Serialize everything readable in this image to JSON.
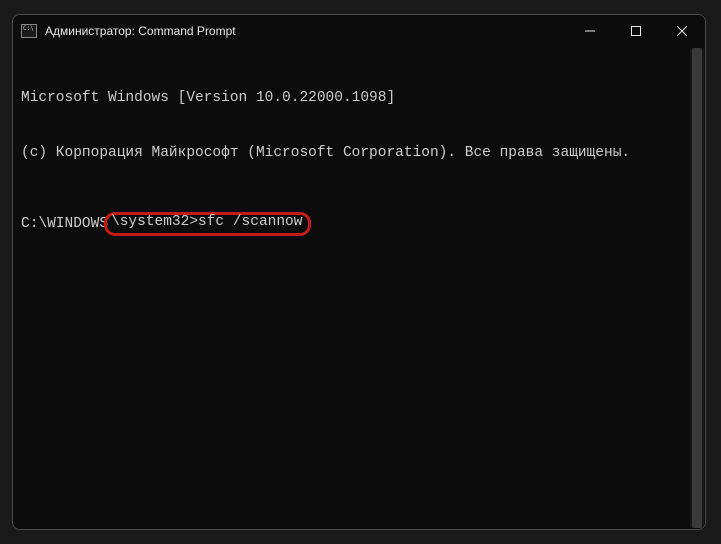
{
  "titlebar": {
    "title": "Администратор: Command Prompt"
  },
  "terminal": {
    "line1": "Microsoft Windows [Version 10.0.22000.1098]",
    "line2": "(c) Корпорация Майкрософт (Microsoft Corporation). Все права защищены.",
    "prompt_prefix": "C:\\WINDOWS",
    "prompt_highlighted": "\\system32>sfc /scannow"
  }
}
